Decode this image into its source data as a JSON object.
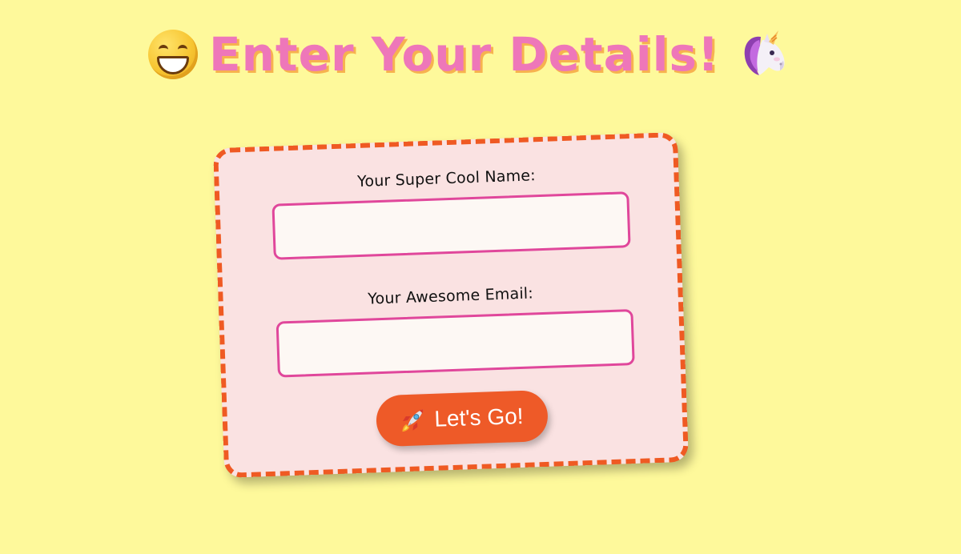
{
  "header": {
    "title": "Enter Your Details!",
    "left_icon": "grinning-face-icon",
    "right_icon": "unicorn-icon"
  },
  "form": {
    "name_label": "Your Super Cool Name:",
    "name_value": "",
    "email_label": "Your Awesome Email:",
    "email_value": "",
    "submit_label": "Let's Go!",
    "submit_icon": "rocket-icon"
  },
  "colors": {
    "background": "#fef99b",
    "title": "#ee77b9",
    "title_shadow": "#f7b24f",
    "card": "#fae2e2",
    "card_border": "#ef5a23",
    "input_border": "#e0479b",
    "button": "#ee5a28"
  }
}
